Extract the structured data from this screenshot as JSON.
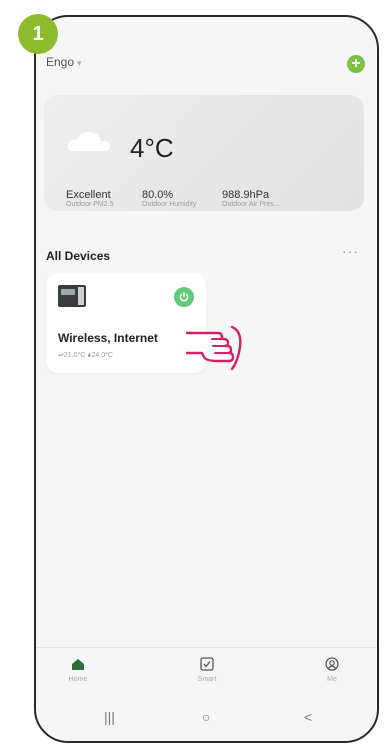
{
  "step": {
    "number": "1",
    "color": "#8dbb2b"
  },
  "header": {
    "home_name": "Engo",
    "caret": "▾",
    "add_icon": "+"
  },
  "weather": {
    "temperature": "4°C",
    "metrics": [
      {
        "value": "Excellent",
        "label": "Outdoor PM2.5"
      },
      {
        "value": "80.0%",
        "label": "Outdoor Humidity"
      },
      {
        "value": "988.9hPa",
        "label": "Outdoor Air Pres..."
      }
    ]
  },
  "devices": {
    "section_title": "All Devices",
    "more": "···",
    "items": [
      {
        "name": "Wireless, Internet",
        "temps": "⇌21.0°C  🌢24.0°C",
        "power_color": "#62c97a"
      }
    ]
  },
  "tabs": [
    {
      "label": "Home",
      "icon": "home-icon"
    },
    {
      "label": "Smart",
      "icon": "checkbox-icon"
    },
    {
      "label": "Me",
      "icon": "user-icon"
    }
  ],
  "navbar": {
    "recents": "|||",
    "home": "○",
    "back": "<"
  }
}
